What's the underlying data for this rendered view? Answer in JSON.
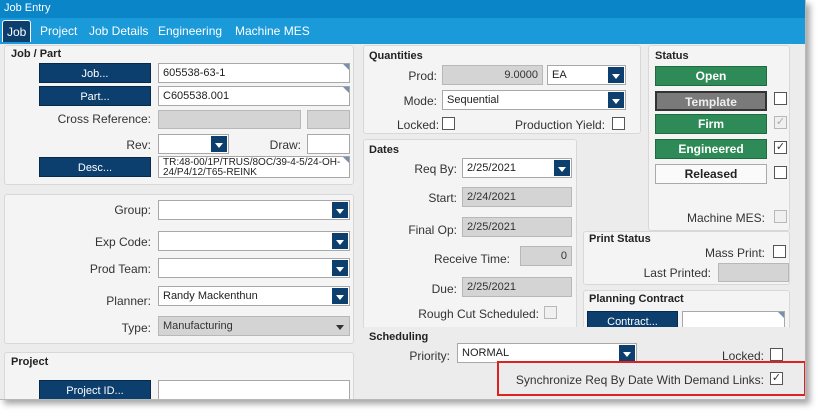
{
  "window": {
    "title": "Job Entry"
  },
  "tabs": [
    {
      "label": "Job",
      "active": true
    },
    {
      "label": "Project"
    },
    {
      "label": "Job Details"
    },
    {
      "label": "Engineering"
    },
    {
      "label": "Machine MES"
    }
  ],
  "job_part": {
    "title": "Job / Part",
    "job_button": "Job...",
    "job_value": "605538-63-1",
    "part_button": "Part...",
    "part_value": "C605538.001",
    "cross_ref_label": "Cross Reference:",
    "rev_label": "Rev:",
    "draw_label": "Draw:",
    "desc_button": "Desc...",
    "desc_value": "TR:48-00/1P/TRUS/8OC/39-4-5/24-OH-24/P4/12/T65-REINK"
  },
  "group_section": {
    "group_label": "Group:",
    "exp_code_label": "Exp Code:",
    "prod_team_label": "Prod Team:",
    "planner_label": "Planner:",
    "planner_value": "Randy Mackenthun",
    "type_label": "Type:",
    "type_value": "Manufacturing"
  },
  "project": {
    "title": "Project",
    "project_id_button": "Project ID..."
  },
  "quantities": {
    "title": "Quantities",
    "prod_label": "Prod:",
    "prod_value": "9.0000",
    "uom_value": "EA",
    "mode_label": "Mode:",
    "mode_value": "Sequential",
    "locked_label": "Locked:",
    "production_yield_label": "Production Yield:"
  },
  "dates": {
    "title": "Dates",
    "req_by_label": "Req By:",
    "req_by_value": "2/25/2021",
    "start_label": "Start:",
    "start_value": "2/24/2021",
    "final_op_label": "Final Op:",
    "final_op_value": "2/25/2021",
    "receive_time_label": "Receive Time:",
    "receive_time_value": "0",
    "due_label": "Due:",
    "due_value": "2/25/2021",
    "rough_cut_label": "Rough Cut Scheduled:"
  },
  "status": {
    "title": "Status",
    "open": "Open",
    "template": "Template",
    "firm": "Firm",
    "engineered": "Engineered",
    "released": "Released",
    "firm_check": "✓",
    "engineered_check": "✓",
    "machine_mes_label": "Machine MES:"
  },
  "print_status": {
    "title": "Print Status",
    "mass_print_label": "Mass Print:",
    "last_printed_label": "Last Printed:"
  },
  "planning_contract": {
    "title": "Planning Contract",
    "contract_button": "Contract..."
  },
  "scheduling": {
    "title": "Scheduling",
    "priority_label": "Priority:",
    "priority_value": "NORMAL",
    "locked_label": "Locked:",
    "sync_label": "Synchronize Req By Date With Demand Links:",
    "sync_check": "✓"
  },
  "colors": {
    "titlebar": "#0a86c8",
    "tabstrip": "#1a9ad8",
    "dark_button": "#0d3f6e",
    "status_green": "#2e8b57",
    "highlight": "#dd2222"
  }
}
